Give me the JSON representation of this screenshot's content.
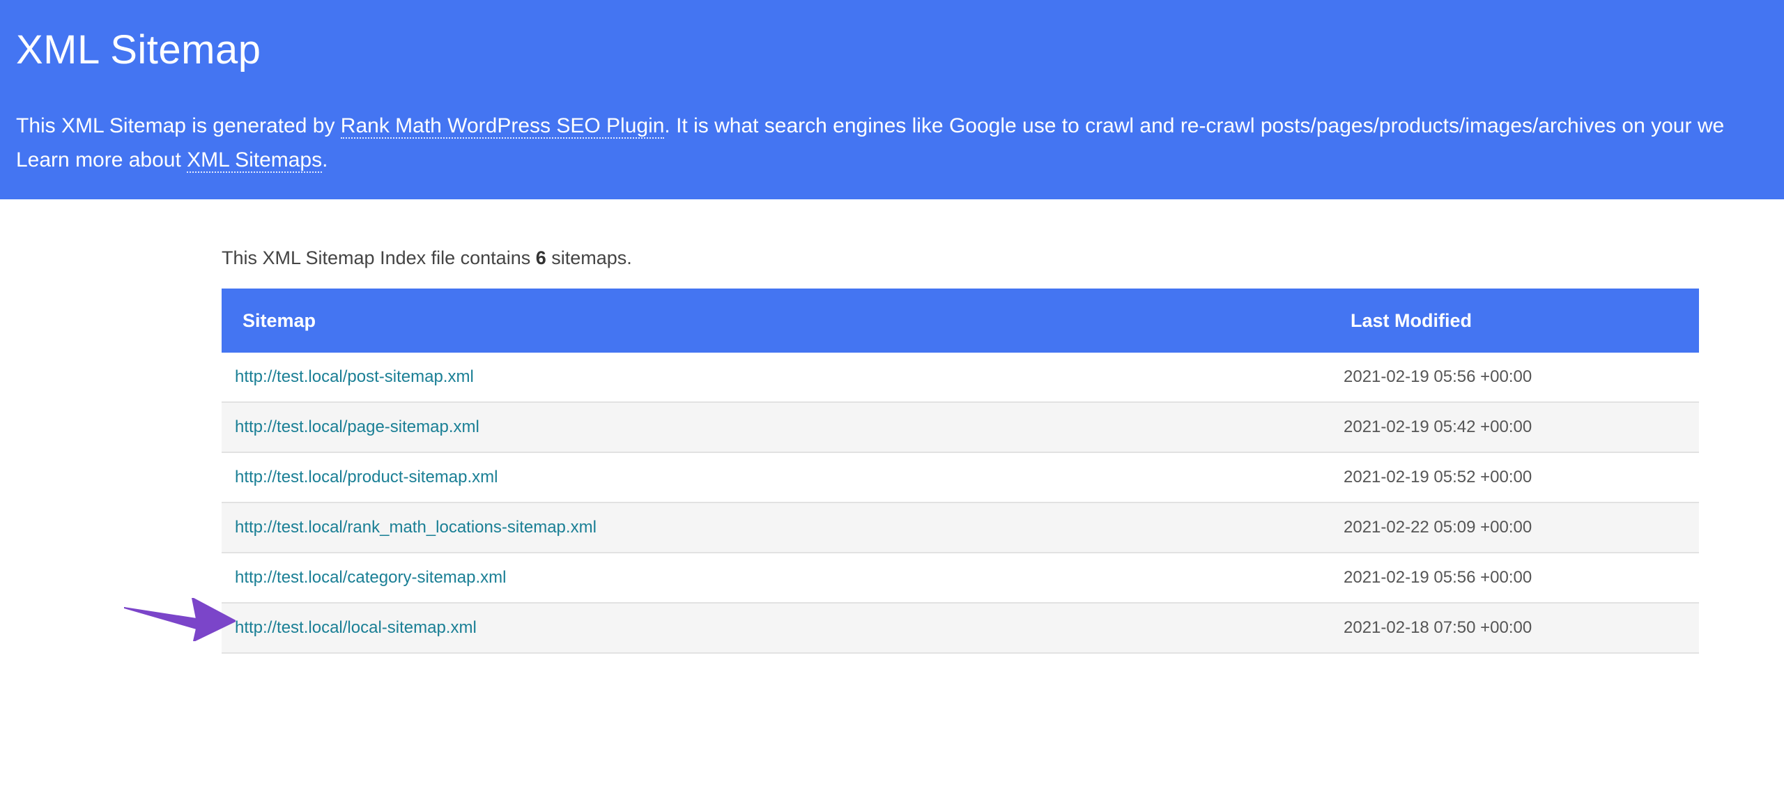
{
  "header": {
    "title": "XML Sitemap",
    "desc_line1_before": "This XML Sitemap is generated by ",
    "desc_link1": "Rank Math WordPress SEO Plugin",
    "desc_line1_after": ". It is what search engines like Google use to crawl and re-crawl posts/pages/products/images/archives on your we",
    "desc_line2_before": "Learn more about ",
    "desc_link2": "XML Sitemaps",
    "desc_line2_after": "."
  },
  "intro": {
    "before": "This XML Sitemap Index file contains ",
    "count": "6",
    "after": " sitemaps."
  },
  "table": {
    "headers": {
      "sitemap": "Sitemap",
      "last_modified": "Last Modified"
    },
    "rows": [
      {
        "url": "http://test.local/post-sitemap.xml",
        "modified": "2021-02-19 05:56 +00:00"
      },
      {
        "url": "http://test.local/page-sitemap.xml",
        "modified": "2021-02-19 05:42 +00:00"
      },
      {
        "url": "http://test.local/product-sitemap.xml",
        "modified": "2021-02-19 05:52 +00:00"
      },
      {
        "url": "http://test.local/rank_math_locations-sitemap.xml",
        "modified": "2021-02-22 05:09 +00:00"
      },
      {
        "url": "http://test.local/category-sitemap.xml",
        "modified": "2021-02-19 05:56 +00:00"
      },
      {
        "url": "http://test.local/local-sitemap.xml",
        "modified": "2021-02-18 07:50 +00:00"
      }
    ]
  },
  "colors": {
    "brand_blue": "#4475f2",
    "link_teal": "#1a7f95",
    "arrow_purple": "#7b45c9"
  },
  "annotation": {
    "icon": "arrow-right-icon"
  }
}
